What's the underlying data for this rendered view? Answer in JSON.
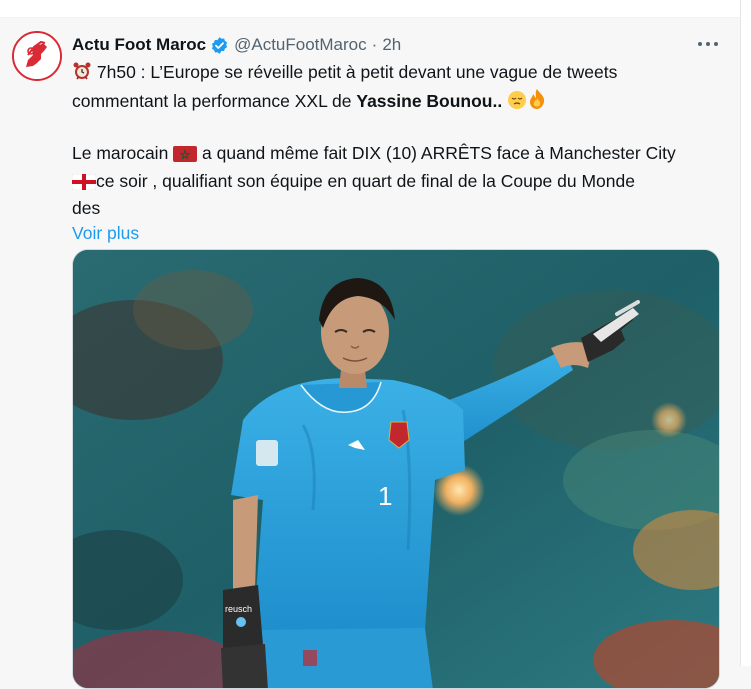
{
  "tweet": {
    "author_name": "Actu Foot Maroc",
    "handle": "@ActuFootMaroc",
    "separator": "·",
    "time": "2h",
    "line1_text": "7h50 : L’Europe se réveille petit à petit devant une vague de tweets",
    "line2_text": "commentant la performance XXL de ",
    "line2_bold": "Yassine Bounou",
    "line2_suffix": "..",
    "line3_a": "Le marocain ",
    "line3_b": " a quand même fait DIX (10) ARRÊTS face à Manchester City",
    "line4_text": "ce soir , qualifiant son équipe en quart de final de la Coupe du Monde",
    "line5_text": "des",
    "read_more": "Voir plus"
  },
  "icons": {
    "verified": "verified-badge-icon",
    "more": "more-dots-icon",
    "alarm": "alarm-clock-emoji",
    "relieved": "relieved-face-emoji",
    "fire": "fire-emoji",
    "morocco_flag": "morocco-flag-emoji",
    "england_flag": "england-flag-emoji"
  },
  "colors": {
    "link": "#1d9bf0",
    "secondary_text": "#536471",
    "primary_text": "#0f1419",
    "jersey_blue": "#2fa3dc"
  },
  "media": {
    "jersey_number": "1",
    "glove_text": "reusch"
  }
}
